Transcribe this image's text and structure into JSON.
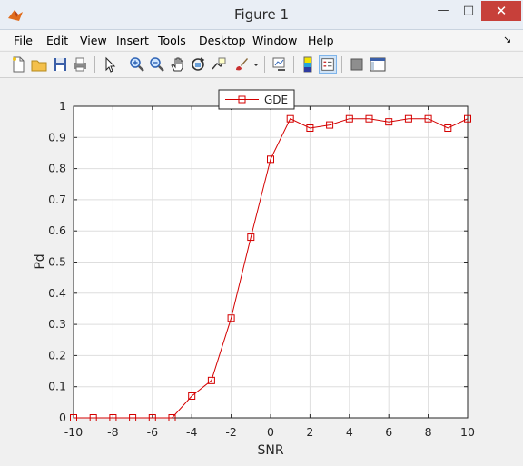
{
  "window": {
    "title": "Figure 1",
    "minimize_glyph": "—",
    "maximize_glyph": "□",
    "close_glyph": "✕"
  },
  "menu": [
    "File",
    "Edit",
    "View",
    "Insert",
    "Tools",
    "Desktop",
    "Window",
    "Help"
  ],
  "toolbar": {
    "icons": [
      "new-figure-icon",
      "open-file-icon",
      "save-icon",
      "print-icon",
      "edit-plot-arrow-icon",
      "zoom-in-icon",
      "zoom-out-icon",
      "pan-hand-icon",
      "rotate-3d-icon",
      "data-cursor-icon",
      "brush-icon",
      "brush-dropdown-icon",
      "link-plot-icon",
      "insert-colorbar-icon",
      "insert-legend-icon",
      "hide-plot-tools-icon",
      "show-plot-tools-icon"
    ]
  },
  "colors": {
    "series": "#d40000",
    "grid": "#d9d9d9",
    "axes": "#262626"
  },
  "chart_data": {
    "type": "line",
    "xlabel": "SNR",
    "ylabel": "Pd",
    "xlim": [
      -10,
      10
    ],
    "ylim": [
      0,
      1
    ],
    "xticks": [
      -10,
      -8,
      -6,
      -4,
      -2,
      0,
      2,
      4,
      6,
      8,
      10
    ],
    "yticks": [
      0,
      0.1,
      0.2,
      0.3,
      0.4,
      0.5,
      0.6,
      0.7,
      0.8,
      0.9,
      1
    ],
    "grid": true,
    "legend_position": "top-center",
    "series": [
      {
        "name": "GDE",
        "marker": "square",
        "color": "#d40000",
        "x": [
          -10,
          -9,
          -8,
          -7,
          -6,
          -5,
          -4,
          -3,
          -2,
          -1,
          0,
          1,
          2,
          3,
          4,
          5,
          6,
          7,
          8,
          9,
          10
        ],
        "y": [
          0,
          0,
          0,
          0,
          0,
          0,
          0.07,
          0.12,
          0.32,
          0.58,
          0.83,
          0.96,
          0.93,
          0.94,
          0.96,
          0.96,
          0.95,
          0.96,
          0.96,
          0.93,
          0.96
        ]
      }
    ]
  }
}
